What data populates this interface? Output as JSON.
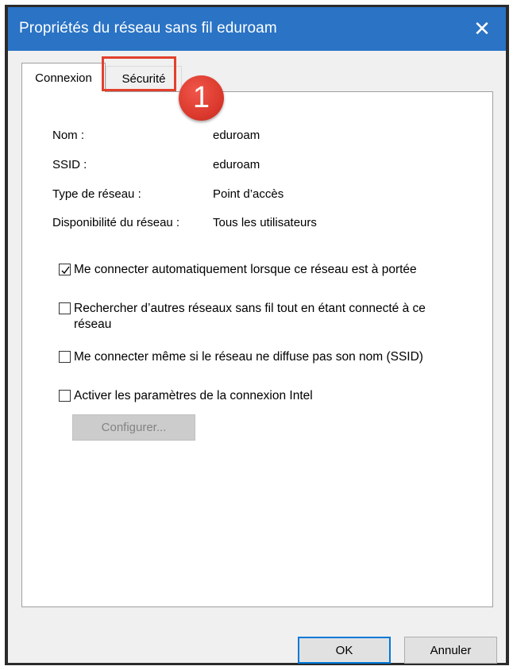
{
  "window": {
    "title": "Propriétés du réseau sans fil eduroam",
    "close_glyph": "✕"
  },
  "tabs": [
    {
      "label": "Connexion",
      "active": true
    },
    {
      "label": "Sécurité",
      "active": false
    }
  ],
  "annotation": {
    "step_number": "1",
    "color": "#e2402d"
  },
  "info": [
    {
      "label": "Nom :",
      "value": "eduroam"
    },
    {
      "label": "SSID :",
      "value": "eduroam"
    },
    {
      "label": "Type de réseau :",
      "value": "Point d’accès"
    },
    {
      "label": "Disponibilité du réseau :",
      "value": "Tous les utilisateurs"
    }
  ],
  "options": [
    {
      "label": "Me connecter automatiquement lorsque ce réseau est à portée",
      "checked": true
    },
    {
      "label": "Rechercher d’autres réseaux sans fil tout en étant connecté à ce réseau",
      "checked": false
    },
    {
      "label": "Me connecter même si le réseau ne diffuse pas son nom (SSID)",
      "checked": false
    },
    {
      "label": "Activer les paramètres de la connexion Intel",
      "checked": false
    }
  ],
  "buttons": {
    "configure": "Configurer...",
    "ok": "OK",
    "cancel": "Annuler"
  },
  "colors": {
    "titlebar": "#2a73c5",
    "default_button_border": "#0078d7"
  }
}
